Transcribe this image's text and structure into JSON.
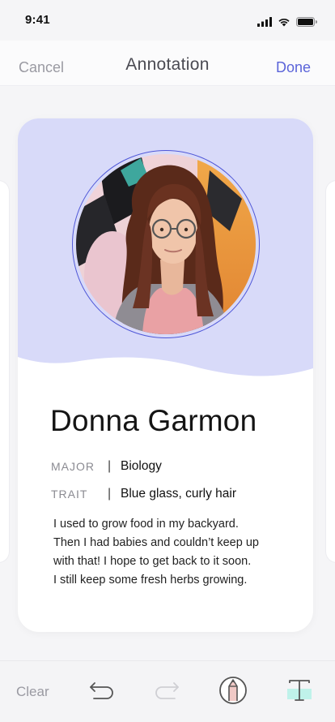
{
  "status_bar": {
    "time": "9:41",
    "icons": [
      "signal-icon",
      "wifi-icon",
      "battery-icon"
    ]
  },
  "nav": {
    "cancel_label": "Cancel",
    "title": "Annotation",
    "done_label": "Done"
  },
  "card": {
    "header_color": "#d8daf9",
    "ring_color": "#5058d8",
    "name": "Donna Garmon",
    "fields": [
      {
        "key": "MAJOR",
        "value": "Biology"
      },
      {
        "key": "TRAIT",
        "value": "Blue glass, curly hair"
      }
    ],
    "bio_lines": [
      "I used to grow food in my backyard.",
      "Then I had babies and couldn’t keep up",
      "with that! I hope to get back to it soon.",
      "I still keep some fresh herbs growing."
    ]
  },
  "toolbar": {
    "clear_label": "Clear",
    "tools": [
      "undo-icon",
      "redo-icon",
      "pencil-tool-icon",
      "text-tool-icon"
    ],
    "accent_color": "#5b64d9"
  }
}
